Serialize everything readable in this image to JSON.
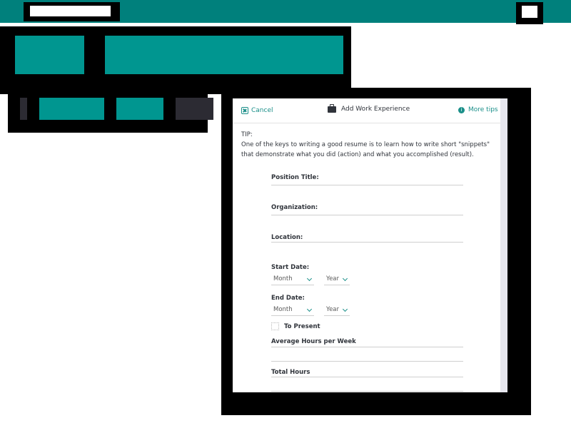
{
  "modal": {
    "cancel_label": "Cancel",
    "title": "Add Work Experience",
    "more_tips_label": "More tips"
  },
  "tip": {
    "heading": "TIP:",
    "text": "One of the keys to writing a good resume is to learn how to write short \"snippets\" that demonstrate what you did (action) and what you accomplished (result)."
  },
  "form": {
    "position_title_label": "Position Title:",
    "organization_label": "Organization:",
    "location_label": "Location:",
    "start_date_label": "Start Date:",
    "end_date_label": "End Date:",
    "month_placeholder": "Month",
    "year_placeholder": "Year",
    "to_present_label": "To Present",
    "average_hours_label": "Average Hours per Week",
    "total_hours_label": "Total Hours"
  }
}
